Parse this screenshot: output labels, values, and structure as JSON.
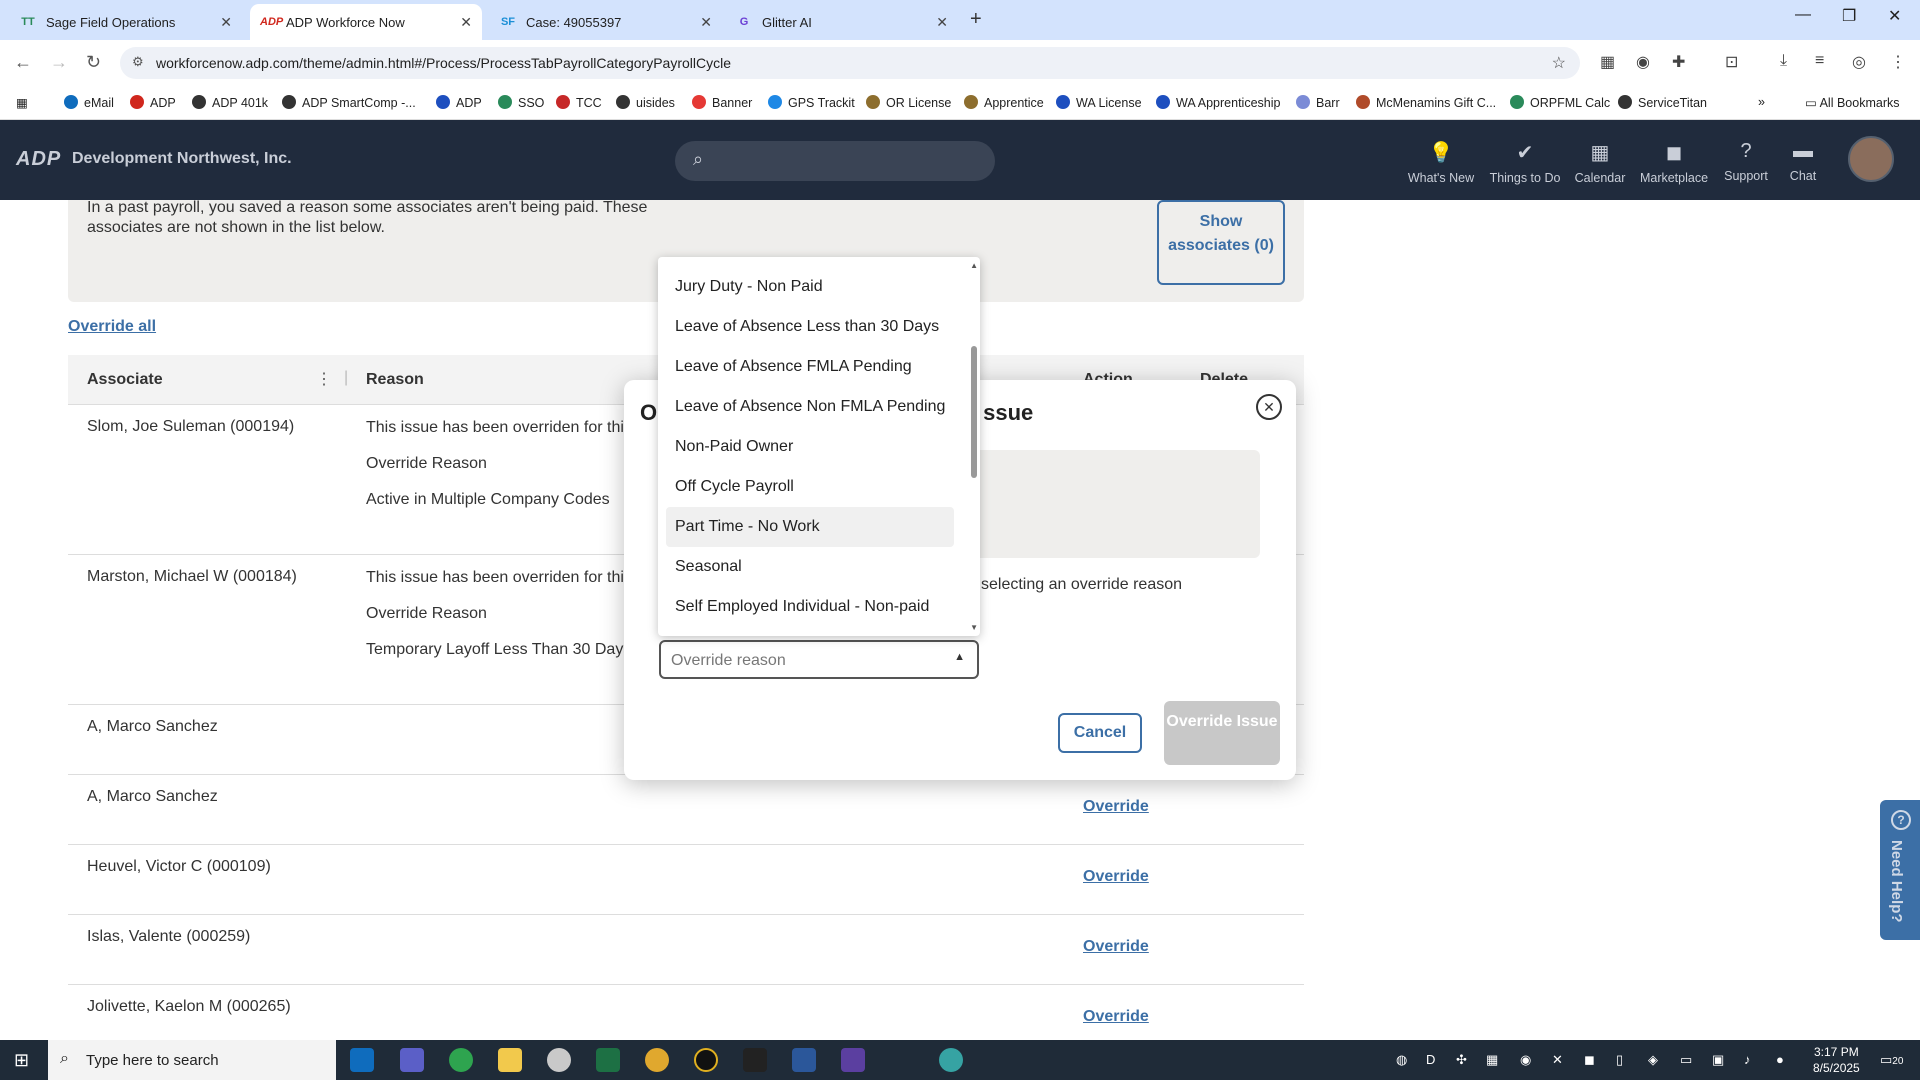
{
  "browser": {
    "tabs": [
      {
        "favicon": "TT",
        "title": "Sage Field Operations"
      },
      {
        "favicon": "ADP",
        "title": "ADP Workforce Now"
      },
      {
        "favicon": "SF",
        "title": "Case: 49055397"
      },
      {
        "favicon": "G",
        "title": "Glitter AI"
      }
    ],
    "url": "workforcenow.adp.com/theme/admin.html#/Process/ProcessTabPayrollCategoryPayrollCycle",
    "bookmarks": [
      "eMail",
      "ADP",
      "ADP 401k",
      "ADP SmartComp -...",
      "ADP",
      "SSO",
      "TCC",
      "uisides",
      "Banner",
      "GPS Trackit",
      "OR License",
      "Apprentice",
      "WA License",
      "WA Apprenticeship",
      "Barr",
      "McMenamins Gift C...",
      "ORPFML Calc",
      "ServiceTitan"
    ],
    "all_bookmarks": "All Bookmarks"
  },
  "header": {
    "logo": "ADP",
    "company": "Development Northwest, Inc.",
    "nav": [
      "What's New",
      "Things to Do",
      "Calendar",
      "Marketplace",
      "Support",
      "Chat"
    ]
  },
  "notice": {
    "text": "In a past payroll, you saved a reason some associates aren't being paid. These associates are not shown in the list below.",
    "show_button": "Show associates (0)"
  },
  "override_all": "Override all",
  "table": {
    "headers": [
      "Associate",
      "Reason",
      "Action",
      "Delete"
    ],
    "rows": [
      {
        "name": "Slom, Joe Suleman (000194)",
        "reason": [
          "This issue has been overriden for this payroll",
          "Override Reason",
          "Active in Multiple Company Codes"
        ]
      },
      {
        "name": "Marston, Michael W (000184)",
        "reason": [
          "This issue has been overriden for this payroll",
          "Override Reason",
          "Temporary Layoff Less Than 30 Days"
        ]
      },
      {
        "name": "A, Marco Sanchez"
      },
      {
        "name": "A, Marco Sanchez",
        "action": "Override"
      },
      {
        "name": "Heuvel, Victor C (000109)",
        "action": "Override"
      },
      {
        "name": "Islas, Valente (000259)",
        "action": "Override"
      },
      {
        "name": "Jolivette, Kaelon M (000265)",
        "action": "Override"
      }
    ]
  },
  "modal": {
    "title_start": "O",
    "title_end": "ssue",
    "hint": "selecting an override reason",
    "select_placeholder": "Override reason",
    "cancel": "Cancel",
    "override_issue": "Override Issue",
    "options": [
      "Jury Duty - Non Paid",
      "Leave of Absence Less than 30 Days",
      "Leave of Absence FMLA Pending",
      "Leave of Absence Non FMLA Pending",
      "Non-Paid Owner",
      "Off Cycle Payroll",
      "Part Time - No Work",
      "Seasonal",
      "Self Employed Individual - Non-paid"
    ],
    "highlighted_option": "Part Time - No Work"
  },
  "need_help": "Need Help?",
  "taskbar": {
    "search_placeholder": "Type here to search",
    "time": "3:17 PM",
    "date": "8/5/2025",
    "notification_count": "20"
  }
}
